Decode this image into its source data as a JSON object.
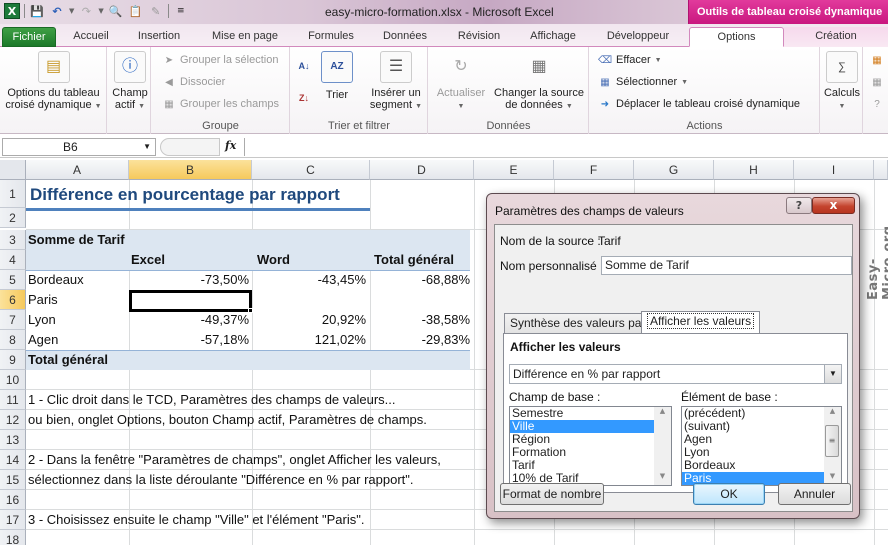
{
  "window": {
    "title": "easy-micro-formation.xlsx  -  Microsoft Excel",
    "context_header": "Outils de tableau croisé dynamique"
  },
  "quick_access": [
    {
      "icon": "excel-logo-icon"
    },
    {
      "icon": "save-icon"
    },
    {
      "icon": "undo-icon"
    },
    {
      "icon": "redo-icon"
    },
    {
      "icon": "print-preview-icon"
    },
    {
      "icon": "paste-icon"
    },
    {
      "icon": "format-painter-icon"
    },
    {
      "icon": "customize-qat-icon"
    }
  ],
  "tabs": [
    {
      "label": "Fichier"
    },
    {
      "label": "Accueil"
    },
    {
      "label": "Insertion"
    },
    {
      "label": "Mise en page"
    },
    {
      "label": "Formules"
    },
    {
      "label": "Données"
    },
    {
      "label": "Révision"
    },
    {
      "label": "Affichage"
    },
    {
      "label": "Développeur"
    },
    {
      "label": "Options",
      "active": true
    },
    {
      "label": "Création"
    }
  ],
  "ribbon": {
    "options_tcd": {
      "line1": "Options du tableau",
      "line2": "croisé dynamique"
    },
    "champ_actif": {
      "line1": "Champ",
      "line2": "actif"
    },
    "groupe": {
      "label": "Groupe",
      "grouper_selection": "Grouper la sélection",
      "dissocier": "Dissocier",
      "grouper_champs": "Grouper les champs"
    },
    "trier_filtrer": {
      "label": "Trier et filtrer",
      "trier": "Trier",
      "inserer_segment_1": "Insérer un",
      "inserer_segment_2": "segment"
    },
    "donnees": {
      "label": "Données",
      "actualiser": "Actualiser",
      "changer_source_1": "Changer la source",
      "changer_source_2": "de données"
    },
    "actions": {
      "label": "Actions",
      "effacer": "Effacer",
      "selectionner": "Sélectionner",
      "deplacer": "Déplacer le tableau croisé dynamique"
    },
    "calculs": {
      "label": "Calculs"
    }
  },
  "formula_bar": {
    "name_box": "B6",
    "fx": "fx",
    "value": ""
  },
  "sheet": {
    "columns": [
      "A",
      "B",
      "C",
      "D",
      "E",
      "F",
      "G",
      "H",
      "I"
    ],
    "selected_column": "B",
    "rows": [
      "1",
      "2",
      "3",
      "4",
      "5",
      "6",
      "7",
      "8",
      "9",
      "10",
      "11",
      "12",
      "13",
      "14",
      "15",
      "16",
      "17",
      "18"
    ],
    "selected_row": "6",
    "title": "Différence en pourcentage par rapport",
    "pivot": {
      "value_label": "Somme de Tarif",
      "col_headers": [
        "Excel",
        "Word",
        "Total général"
      ],
      "rows": [
        {
          "label": "Bordeaux",
          "values": [
            "-73,50%",
            "-43,45%",
            "-68,88%"
          ]
        },
        {
          "label": "Paris",
          "values": [
            "",
            "",
            ""
          ]
        },
        {
          "label": "Lyon",
          "values": [
            "-49,37%",
            "20,92%",
            "-38,58%"
          ]
        },
        {
          "label": "Agen",
          "values": [
            "-57,18%",
            "121,02%",
            "-29,83%"
          ]
        }
      ],
      "total_label": "Total général"
    },
    "notes": {
      "r11": "1  - Clic droit dans le TCD, Paramètres des champs de valeurs...",
      "r12": "ou bien, onglet Options, bouton Champ actif, Paramètres de champs.",
      "r14": "2 - Dans la fenêtre \"Paramètres de champs\", onglet Afficher les valeurs,",
      "r15": "sélectionnez dans la liste déroulante \"Différence en % par rapport\".",
      "r17": "3 - Choisissez ensuite le champ \"Ville\" et l'élément \"Paris\"."
    }
  },
  "watermark": "Easy-Micro.org",
  "dialog": {
    "title": "Paramètres des champs de valeurs",
    "help": "?",
    "close": "x",
    "source_label": "Nom de la source :",
    "source_value": "Tarif",
    "custom_name_label": "Nom personnalisé :",
    "custom_name_value": "Somme de Tarif",
    "tabs": [
      "Synthèse des valeurs par",
      "Afficher les valeurs"
    ],
    "active_tab": "Afficher les valeurs",
    "section_heading": "Afficher les valeurs",
    "show_as_value": "Différence en % par rapport",
    "base_field_label": "Champ de base :",
    "base_fields": [
      "Semestre",
      "Ville",
      "Région",
      "Formation",
      "Tarif",
      " 10% de Tarif"
    ],
    "base_field_selected": "Ville",
    "base_item_label": "Élément de base :",
    "base_items": [
      "(précédent)",
      "(suivant)",
      "Agen",
      "Lyon",
      "Bordeaux",
      "Paris"
    ],
    "base_item_selected": "Paris",
    "number_format_button": "Format de nombre",
    "ok_button": "OK",
    "cancel_button": "Annuler"
  }
}
